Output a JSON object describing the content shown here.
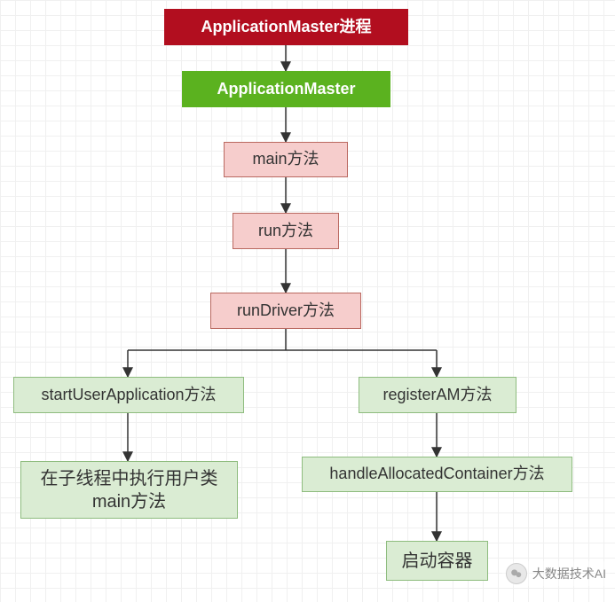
{
  "nodes": {
    "n1": "ApplicationMaster进程",
    "n2": "ApplicationMaster",
    "n3": "main方法",
    "n4": "run方法",
    "n5": "runDriver方法",
    "n6": "startUserApplication方法",
    "n7": "在子线程中执行用户类main方法",
    "n8": "registerAM方法",
    "n9": "handleAllocatedContainer方法",
    "n10": "启动容器"
  },
  "watermark": {
    "text": "大数据技术AI"
  },
  "edges": [
    {
      "from": "n1",
      "to": "n2"
    },
    {
      "from": "n2",
      "to": "n3"
    },
    {
      "from": "n3",
      "to": "n4"
    },
    {
      "from": "n4",
      "to": "n5"
    },
    {
      "from": "n5",
      "to": "n6"
    },
    {
      "from": "n5",
      "to": "n8"
    },
    {
      "from": "n6",
      "to": "n7"
    },
    {
      "from": "n8",
      "to": "n9"
    },
    {
      "from": "n9",
      "to": "n10"
    }
  ]
}
